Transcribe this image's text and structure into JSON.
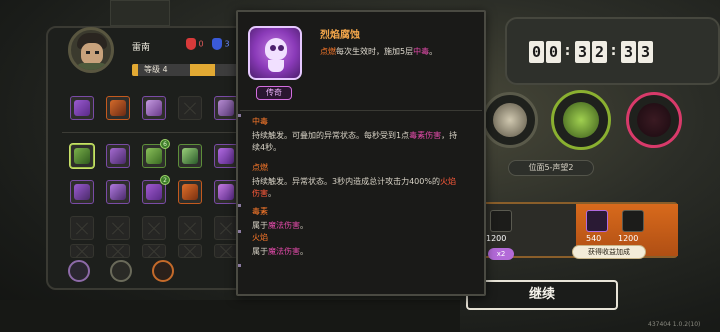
{
  "character": {
    "name": "雷南",
    "red_stat": "0",
    "blue_stat": "3",
    "level_label": "等级 4",
    "level_progress": 0.55
  },
  "item_grid": {
    "row1": [
      "purple",
      "orange",
      "purple",
      "empty",
      "purple"
    ],
    "row2": [
      "green",
      "purple",
      "green",
      "green",
      "purple"
    ],
    "row3": [
      "purple",
      "purple",
      "purple",
      "orange",
      "purple"
    ],
    "row4": [
      "empty",
      "empty",
      "empty",
      "empty",
      "empty"
    ],
    "row5": [
      "empty",
      "empty",
      "empty",
      "empty",
      "empty"
    ],
    "badges": {
      "r2c3": "6",
      "r3c3": "2"
    }
  },
  "timer": {
    "digits": [
      "0",
      "0",
      "3",
      "2",
      "3",
      "3"
    ]
  },
  "position_label": "位面5-声望2",
  "rewards": {
    "values": [
      "1200",
      "540",
      "1200"
    ],
    "multiplier": "x2",
    "bonus_button": "获得收益加成"
  },
  "continue_button": "继续",
  "version": "437404 1.0.2(10)",
  "tooltip": {
    "title": "烈焰腐蚀",
    "rarity": "传奇",
    "desc_prefix": "点燃",
    "desc_mid": "每次生效时，施加5层",
    "desc_suffix": "中毒",
    "desc_end": "。",
    "terms": [
      {
        "name": "中毒",
        "body_line1": "持续触发。可叠加的异常状态。每秒受到1点",
        "hl1": "毒素伤害",
        "body_line1_end": "，持",
        "body_line2": "续4秒。"
      },
      {
        "name": "点燃",
        "body_line1": "持续触发。异常状态。3秒内造成总计攻击力400%的",
        "hl1": "火焰",
        "body_line2_hl": "伤害",
        "body_line2": "。"
      },
      {
        "name": "毒素",
        "body_line1": "属于",
        "hl1": "魔法伤害",
        "body_line1_end": "。"
      },
      {
        "name": "火焰",
        "body_line1": "属于",
        "hl1": "魔法伤害",
        "body_line1_end": "。"
      }
    ]
  },
  "colors": {
    "accent_orange": "#e2a933",
    "rarity_purple": "#d46ee0",
    "highlight_orange": "#ff7a2a",
    "highlight_pink": "#e04aa8"
  }
}
